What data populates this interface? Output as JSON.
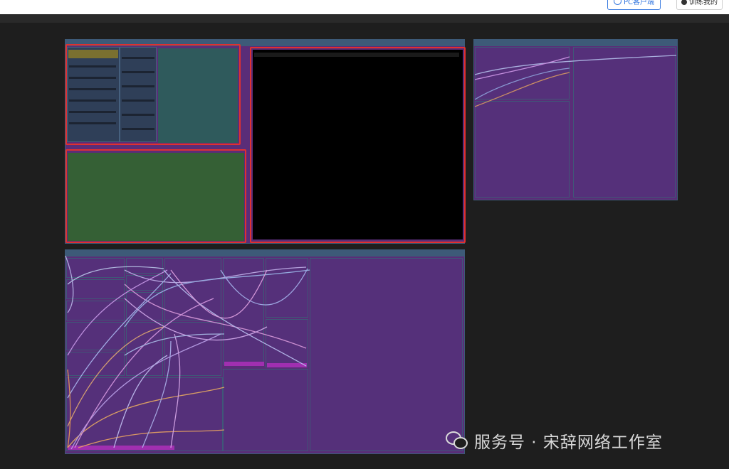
{
  "toolbar": {
    "client_button": "PC客户端",
    "train_button": "训练我的"
  },
  "groups": {
    "top_left_title": "",
    "top_right_title": "",
    "bottom_title": ""
  },
  "watermark": {
    "icon": "wechat-icon",
    "text": "服务号 · 宋辞网络工作室"
  },
  "colors": {
    "canvas": "#1e1e1e",
    "group": "#5a2d78",
    "group_header": "#3d5a78",
    "highlight": "#e03030",
    "preview_green": "#356035",
    "preview_teal": "#2f5a5c"
  }
}
